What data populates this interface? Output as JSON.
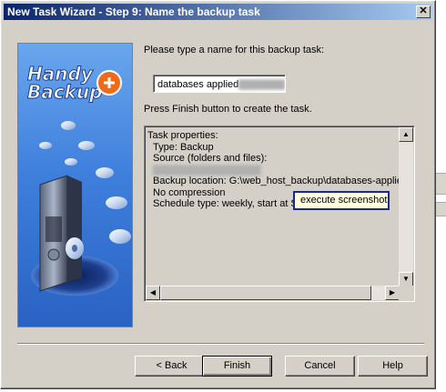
{
  "window": {
    "title": "New Task Wizard - Step 9: Name the backup task",
    "close_glyph": "✕"
  },
  "branding": {
    "logo_line1": "Handy",
    "logo_line2": "Backup"
  },
  "form": {
    "prompt": "Please type a name for this backup task:",
    "task_name_value": "databases applied",
    "finish_note": "Press Finish button to create the task."
  },
  "properties": {
    "heading": "Task properties:",
    "type": "Type: Backup",
    "source_label": "Source (folders and files):",
    "backup_location": "Backup location: G:\\web_host_backup\\databases-applie",
    "compression": "No compression",
    "schedule": "Schedule type: weekly, start at S"
  },
  "tooltip": {
    "text": "execute screenshot"
  },
  "buttons": {
    "back": "< Back",
    "finish": "Finish",
    "cancel": "Cancel",
    "help": "Help"
  },
  "icons": {
    "scroll_up": "▲",
    "scroll_down": "▼",
    "scroll_left": "◀",
    "scroll_right": "▶"
  }
}
